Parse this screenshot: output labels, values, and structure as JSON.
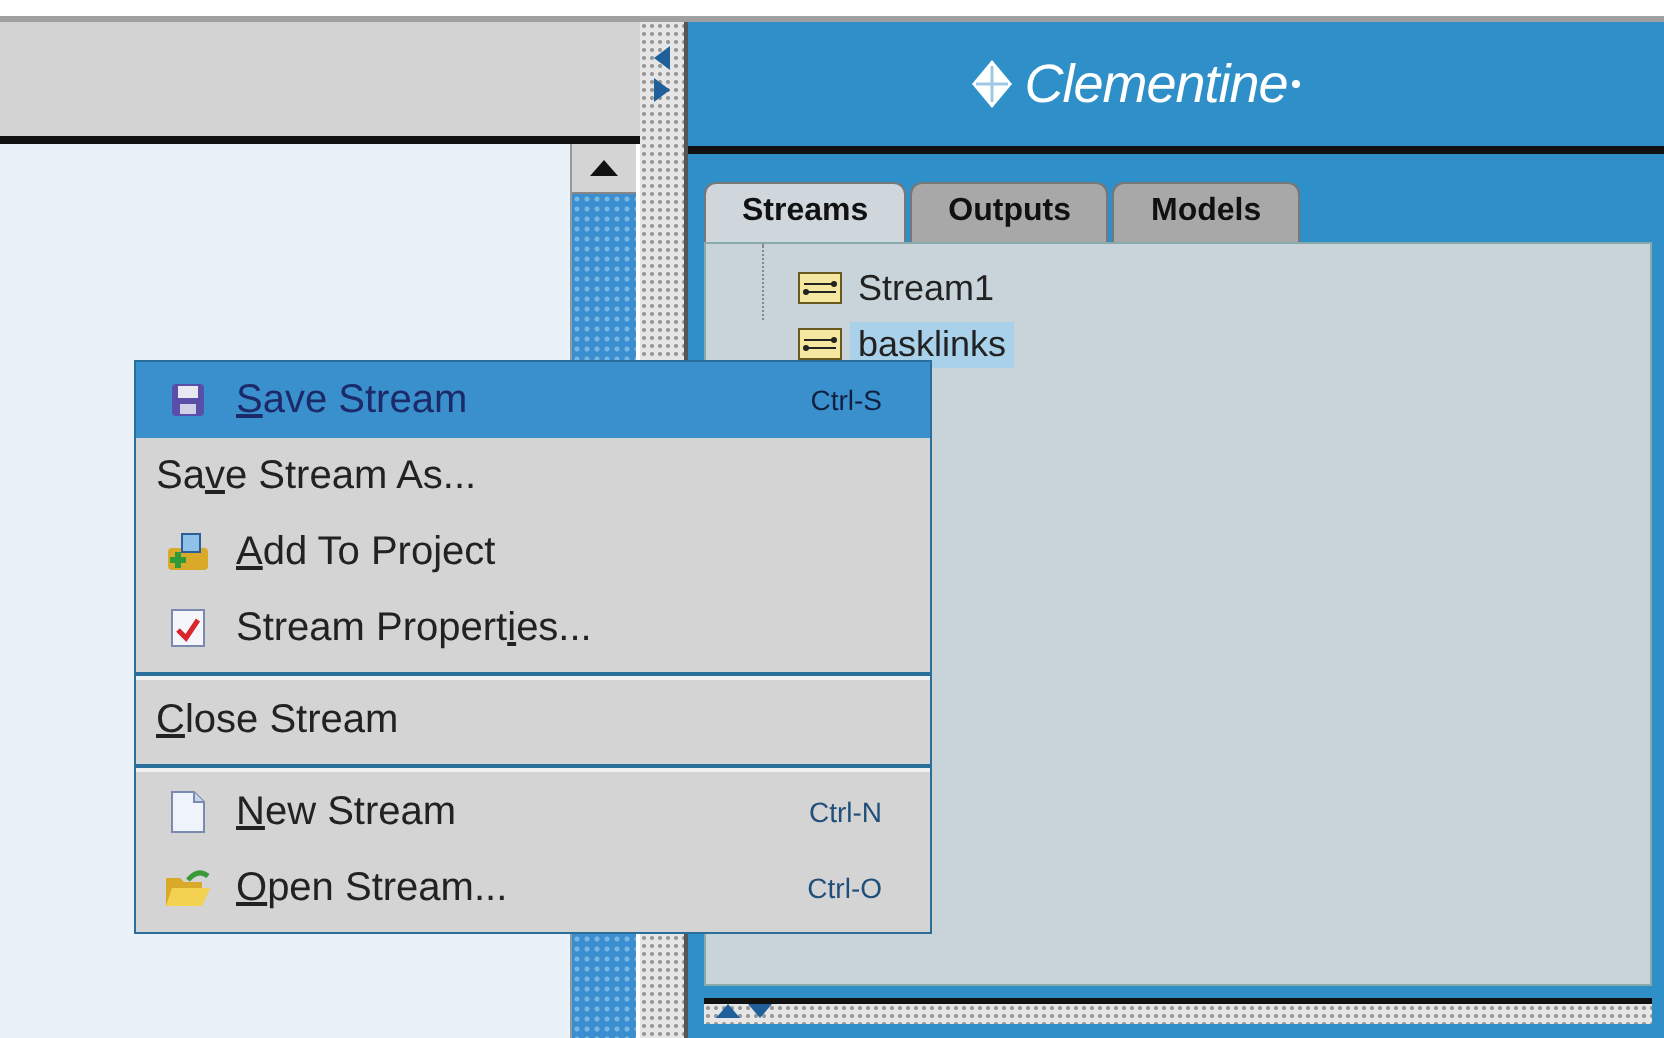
{
  "header": {
    "logo": "Clementine"
  },
  "tabs": [
    {
      "label": "Streams",
      "selected": true
    },
    {
      "label": "Outputs",
      "selected": false
    },
    {
      "label": "Models",
      "selected": false
    }
  ],
  "tree": [
    {
      "label": "Stream1",
      "selected": false
    },
    {
      "label": "basklinks",
      "selected": true
    }
  ],
  "context_menu": {
    "groups": [
      [
        {
          "key": "S",
          "post": "ave Stream",
          "shortcut": "Ctrl-S",
          "kind": "save",
          "selected": true
        },
        {
          "pre": "Sa",
          "key": "v",
          "post": "e Stream As...",
          "selected": false
        },
        {
          "key": "A",
          "post": "dd To Project",
          "kind": "project",
          "selected": false
        },
        {
          "pre": "Stream Propert",
          "key": "i",
          "post": "es...",
          "kind": "properties",
          "selected": false
        }
      ],
      [
        {
          "key": "C",
          "post": "lose Stream",
          "selected": false
        }
      ],
      [
        {
          "key": "N",
          "post": "ew Stream",
          "shortcut": "Ctrl-N",
          "kind": "new",
          "selected": false
        },
        {
          "key": "O",
          "post": "pen Stream...",
          "shortcut": "Ctrl-O",
          "kind": "open",
          "selected": false
        }
      ]
    ]
  }
}
